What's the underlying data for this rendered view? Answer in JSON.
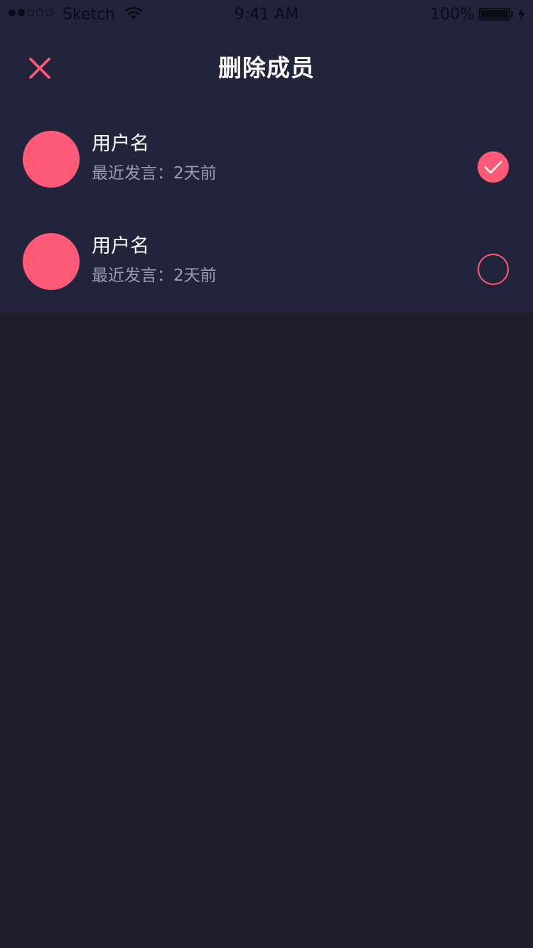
{
  "status_bar": {
    "carrier": "Sketch",
    "time": "9:41 AM",
    "battery": "100%"
  },
  "header": {
    "title": "删除成员"
  },
  "members": [
    {
      "name": "用户名",
      "meta": "最近发言：2天前",
      "selected": true
    },
    {
      "name": "用户名",
      "meta": "最近发言：2天前",
      "selected": false
    }
  ],
  "colors": {
    "accent": "#ff5a78",
    "panel": "#23233b",
    "background": "#1e1c2d"
  },
  "icons": {
    "close": "close-icon",
    "checked": "check-circle-icon",
    "unchecked": "empty-circle-icon"
  }
}
